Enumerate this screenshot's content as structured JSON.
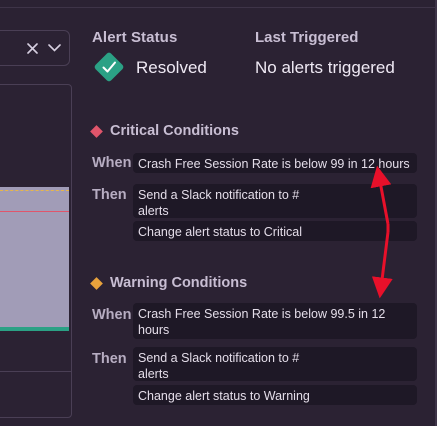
{
  "filter": {
    "clear_icon": "close-icon",
    "dropdown_icon": "chevron-down-icon"
  },
  "status": {
    "status_label": "Alert Status",
    "status_value": "Resolved",
    "status_color": "#2ba185",
    "last_label": "Last Triggered",
    "last_value": "No alerts triggered"
  },
  "critical": {
    "heading": "Critical Conditions",
    "color": "#e0556b",
    "when_label": "When",
    "when_text": "Crash Free Session Rate is below 99 in 12 hours",
    "then_label": "Then",
    "actions": [
      "Send a Slack notification to #\nalerts",
      "Change alert status to Critical"
    ]
  },
  "warning": {
    "heading": "Warning Conditions",
    "color": "#e8a23c",
    "when_label": "When",
    "when_text": "Crash Free Session Rate is below 99.5 in 12\nhours",
    "then_label": "Then",
    "actions": [
      "Send a Slack notification to #\nalerts",
      "Change alert status to Warning"
    ]
  },
  "annotation": {
    "arrow_color": "#e8102a"
  }
}
